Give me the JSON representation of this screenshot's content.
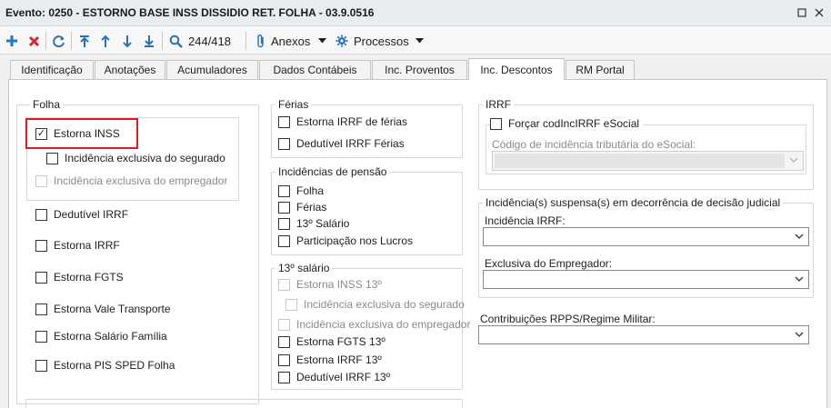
{
  "window": {
    "title": "Evento: 0250 - ESTORNO BASE INSS DISSIDIO RET. FOLHA - 03.9.0516",
    "restore_icon": "restore-icon",
    "close_icon": "close-icon"
  },
  "toolbar": {
    "record_counter": "244/418",
    "anexos_label": "Anexos",
    "processos_label": "Processos"
  },
  "tabs": [
    {
      "label": "Identificação"
    },
    {
      "label": "Anotações"
    },
    {
      "label": "Acumuladores"
    },
    {
      "label": "Dados Contábeis"
    },
    {
      "label": "Inc. Proventos"
    },
    {
      "label": "Inc. Descontos",
      "active": true
    },
    {
      "label": "RM Portal"
    }
  ],
  "folha": {
    "title": "Folha",
    "estorna_inss": {
      "label": "Estorna INSS",
      "checked": true
    },
    "inc_segurado": {
      "label": "Incidência exclusiva do segurado",
      "checked": false
    },
    "inc_empregador": {
      "label": "Incidência exclusiva do empregador",
      "checked": false,
      "disabled": true
    },
    "items": [
      {
        "label": "Dedutível IRRF"
      },
      {
        "label": "Estorna IRRF"
      },
      {
        "label": "Estorna FGTS"
      },
      {
        "label": "Estorna Vale Transporte"
      },
      {
        "label": "Estorna Salário Família"
      },
      {
        "label": "Estorna PIS SPED Folha"
      }
    ]
  },
  "ferias": {
    "title": "Férias",
    "items": [
      {
        "label": "Estorna IRRF de férias"
      },
      {
        "label": "Dedutível IRRF Férias"
      }
    ]
  },
  "pensao": {
    "title": "Incidências de pensão",
    "items": [
      {
        "label": "Folha"
      },
      {
        "label": "Férias"
      },
      {
        "label": "13º Salário"
      },
      {
        "label": "Participação nos Lucros"
      }
    ]
  },
  "decimo": {
    "title": "13º salário",
    "estorna_inss": {
      "label": "Estorna INSS 13º",
      "disabled": true
    },
    "inc_segurado": {
      "label": "Incidência exclusiva do segurado",
      "disabled": true
    },
    "inc_empregador": {
      "label": "Incidência exclusiva do empregador",
      "disabled": true
    },
    "items": [
      {
        "label": "Estorna FGTS 13º"
      },
      {
        "label": "Estorna IRRF 13º"
      },
      {
        "label": "Dedutível IRRF 13º"
      }
    ]
  },
  "irrf": {
    "title": "IRRF",
    "forcar": {
      "label": "Forçar codIncIRRF eSocial",
      "checked": false
    },
    "codigo_label": "Código de incidência tributária do eSocial:",
    "codigo_value": ""
  },
  "suspensa": {
    "title": "Incidência(s) suspensa(s) em decorrência de decisão judicial",
    "irrf_label": "Incidência IRRF:",
    "irrf_value": "",
    "empregador_label": "Exclusiva do Empregador:",
    "empregador_value": ""
  },
  "rpps": {
    "label": "Contribuições RPPS/Regime Militar:",
    "value": ""
  },
  "colors": {
    "add": "#1e7bc3",
    "delete": "#d42a2a",
    "toolbar_icon": "#2a72b8",
    "highlight": "#e01b1b"
  }
}
